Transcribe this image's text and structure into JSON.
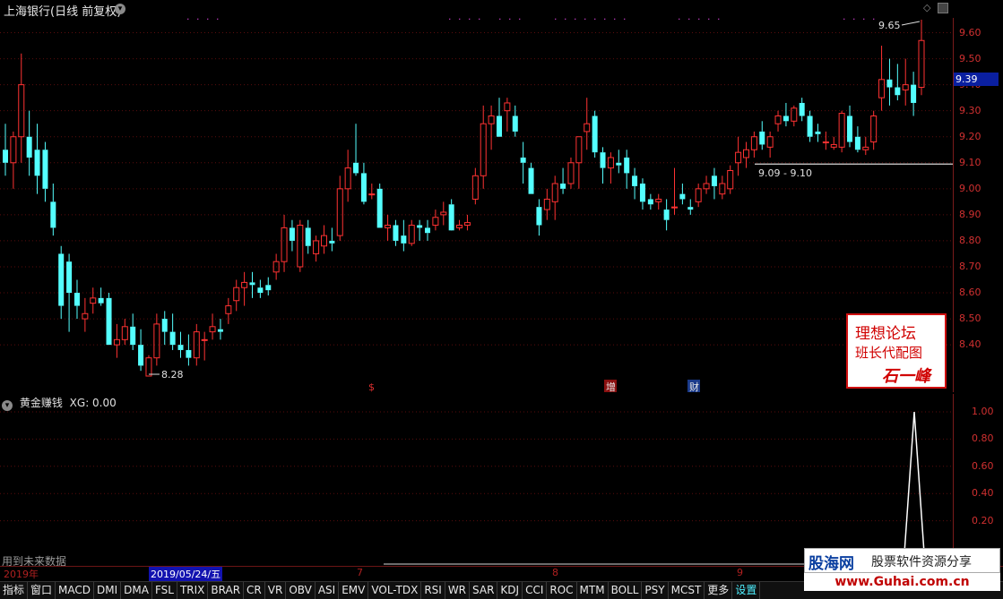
{
  "window": {
    "title": "上海银行(日线 前复权)",
    "title_dropdown_icon": "chevron-down-icon"
  },
  "main_chart": {
    "y_ticks": [
      "9.60",
      "9.50",
      "9.40",
      "9.30",
      "9.20",
      "9.10",
      "9.00",
      "8.90",
      "8.80",
      "8.70",
      "8.60",
      "8.50",
      "8.40"
    ],
    "current_price": "9.39",
    "annot_high": "9.65",
    "annot_low": "8.28",
    "range_label": "9.09 - 9.10",
    "event_markers": [
      {
        "label": "$",
        "color": "#e03030"
      },
      {
        "label": "增",
        "color": "#e8e8e8",
        "bg": "#8a1010"
      },
      {
        "label": "财",
        "color": "#e8e8e8",
        "bg": "#1a3a8a"
      }
    ],
    "up_color": "#ff3232",
    "down_color": "#54ffff",
    "watermark": {
      "line1": "理想论坛",
      "line2": "班长代配图",
      "line3": "石一峰"
    }
  },
  "indicator": {
    "name": "黄金赚钱",
    "value_text": "XG: 0.00",
    "y_ticks": [
      "1.00",
      "0.80",
      "0.60",
      "0.40",
      "0.20"
    ],
    "footnote": "用到未来数据"
  },
  "time_axis": {
    "year": "2019年",
    "months": [
      "7",
      "8",
      "9"
    ],
    "selected_date": "2019/05/24/五"
  },
  "tabs": [
    "指标",
    "窗口",
    "MACD",
    "DMI",
    "DMA",
    "FSL",
    "TRIX",
    "BRAR",
    "CR",
    "VR",
    "OBV",
    "ASI",
    "EMV",
    "VOL-TDX",
    "RSI",
    "WR",
    "SAR",
    "KDJ",
    "CCI",
    "ROC",
    "MTM",
    "BOLL",
    "PSY",
    "MCST",
    "更多",
    "设置"
  ],
  "brand": {
    "name": "股海网",
    "slogan": "股票软件资源分享",
    "url": "www.Guhai.com.cn"
  },
  "chart_data": {
    "type": "candlestick",
    "title": "上海银行(日线 前复权)",
    "ylim": [
      8.28,
      9.65
    ],
    "candles": [
      [
        9.15,
        9.25,
        9.05,
        9.1
      ],
      [
        9.1,
        9.22,
        9.0,
        9.2
      ],
      [
        9.2,
        9.52,
        9.1,
        9.4
      ],
      [
        9.2,
        9.3,
        9.05,
        9.12
      ],
      [
        9.15,
        9.25,
        8.98,
        9.05
      ],
      [
        9.15,
        9.18,
        8.95,
        9.0
      ],
      [
        8.95,
        9.02,
        8.82,
        8.85
      ],
      [
        8.75,
        8.78,
        8.5,
        8.55
      ],
      [
        8.72,
        8.75,
        8.45,
        8.6
      ],
      [
        8.6,
        8.65,
        8.5,
        8.55
      ],
      [
        8.5,
        8.58,
        8.45,
        8.52
      ],
      [
        8.56,
        8.62,
        8.52,
        8.58
      ],
      [
        8.58,
        8.62,
        8.55,
        8.56
      ],
      [
        8.58,
        8.6,
        8.4,
        8.4
      ],
      [
        8.4,
        8.48,
        8.35,
        8.42
      ],
      [
        8.42,
        8.5,
        8.4,
        8.47
      ],
      [
        8.47,
        8.52,
        8.38,
        8.4
      ],
      [
        8.4,
        8.46,
        8.3,
        8.32
      ],
      [
        8.28,
        8.36,
        8.28,
        8.35
      ],
      [
        8.35,
        8.52,
        8.32,
        8.48
      ],
      [
        8.5,
        8.53,
        8.4,
        8.45
      ],
      [
        8.45,
        8.52,
        8.38,
        8.4
      ],
      [
        8.4,
        8.45,
        8.35,
        8.38
      ],
      [
        8.38,
        8.44,
        8.32,
        8.35
      ],
      [
        8.35,
        8.48,
        8.32,
        8.45
      ],
      [
        8.42,
        8.45,
        8.34,
        8.42
      ],
      [
        8.45,
        8.52,
        8.42,
        8.47
      ],
      [
        8.46,
        8.5,
        8.42,
        8.45
      ],
      [
        8.52,
        8.58,
        8.48,
        8.55
      ],
      [
        8.57,
        8.65,
        8.53,
        8.62
      ],
      [
        8.62,
        8.68,
        8.55,
        8.64
      ],
      [
        8.64,
        8.68,
        8.58,
        8.63
      ],
      [
        8.62,
        8.65,
        8.58,
        8.6
      ],
      [
        8.63,
        8.66,
        8.59,
        8.61
      ],
      [
        8.68,
        8.75,
        8.65,
        8.72
      ],
      [
        8.72,
        8.9,
        8.68,
        8.85
      ],
      [
        8.85,
        8.88,
        8.76,
        8.8
      ],
      [
        8.7,
        8.88,
        8.68,
        8.86
      ],
      [
        8.85,
        8.88,
        8.75,
        8.78
      ],
      [
        8.75,
        8.82,
        8.72,
        8.8
      ],
      [
        8.78,
        8.86,
        8.75,
        8.82
      ],
      [
        8.8,
        8.85,
        8.76,
        8.79
      ],
      [
        8.82,
        9.05,
        8.8,
        9.0
      ],
      [
        9.0,
        9.15,
        8.95,
        9.08
      ],
      [
        9.1,
        9.25,
        9.05,
        9.06
      ],
      [
        9.06,
        9.1,
        8.94,
        8.95
      ],
      [
        8.98,
        9.02,
        8.96,
        8.98
      ],
      [
        9.0,
        9.02,
        8.85,
        8.85
      ],
      [
        8.85,
        8.9,
        8.8,
        8.86
      ],
      [
        8.86,
        8.88,
        8.78,
        8.8
      ],
      [
        8.82,
        8.88,
        8.76,
        8.79
      ],
      [
        8.79,
        8.88,
        8.78,
        8.86
      ],
      [
        8.86,
        8.88,
        8.8,
        8.85
      ],
      [
        8.85,
        8.88,
        8.8,
        8.83
      ],
      [
        8.86,
        8.92,
        8.84,
        8.89
      ],
      [
        8.9,
        8.95,
        8.86,
        8.91
      ],
      [
        8.94,
        8.96,
        8.85,
        8.84
      ],
      [
        8.85,
        8.88,
        8.84,
        8.86
      ],
      [
        8.86,
        8.9,
        8.84,
        8.87
      ],
      [
        8.96,
        9.08,
        8.94,
        9.05
      ],
      [
        9.05,
        9.32,
        9.0,
        9.25
      ],
      [
        9.25,
        9.32,
        9.15,
        9.28
      ],
      [
        9.28,
        9.35,
        9.2,
        9.2
      ],
      [
        9.3,
        9.35,
        9.22,
        9.33
      ],
      [
        9.28,
        9.32,
        9.2,
        9.22
      ],
      [
        9.12,
        9.18,
        9.02,
        9.1
      ],
      [
        9.08,
        9.1,
        8.98,
        8.98
      ],
      [
        8.93,
        8.96,
        8.82,
        8.86
      ],
      [
        8.92,
        9.0,
        8.88,
        8.96
      ],
      [
        8.95,
        9.05,
        8.88,
        9.02
      ],
      [
        9.02,
        9.08,
        8.98,
        9.0
      ],
      [
        9.02,
        9.12,
        9.0,
        9.1
      ],
      [
        9.1,
        9.2,
        9.0,
        9.2
      ],
      [
        9.22,
        9.35,
        9.15,
        9.25
      ],
      [
        9.28,
        9.3,
        9.12,
        9.14
      ],
      [
        9.14,
        9.16,
        9.02,
        9.08
      ],
      [
        9.08,
        9.14,
        9.02,
        9.12
      ],
      [
        9.1,
        9.15,
        9.06,
        9.09
      ],
      [
        9.12,
        9.15,
        9.0,
        9.06
      ],
      [
        9.05,
        9.08,
        8.96,
        9.01
      ],
      [
        9.02,
        9.04,
        8.92,
        8.95
      ],
      [
        8.96,
        8.98,
        8.92,
        8.94
      ],
      [
        8.95,
        8.98,
        8.92,
        8.96
      ],
      [
        8.92,
        8.96,
        8.84,
        8.88
      ],
      [
        8.93,
        9.08,
        8.9,
        8.93
      ],
      [
        8.98,
        9.02,
        8.94,
        8.96
      ],
      [
        8.93,
        8.96,
        8.9,
        8.92
      ],
      [
        8.95,
        9.02,
        8.93,
        9.0
      ],
      [
        9.0,
        9.05,
        8.98,
        9.02
      ],
      [
        9.05,
        9.08,
        8.96,
        9.01
      ],
      [
        8.98,
        9.05,
        8.96,
        9.02
      ],
      [
        9.0,
        9.09,
        8.98,
        9.07
      ],
      [
        9.1,
        9.2,
        9.05,
        9.14
      ],
      [
        9.12,
        9.18,
        9.08,
        9.15
      ],
      [
        9.15,
        9.22,
        9.12,
        9.2
      ],
      [
        9.22,
        9.26,
        9.15,
        9.17
      ],
      [
        9.16,
        9.22,
        9.12,
        9.2
      ],
      [
        9.25,
        9.3,
        9.22,
        9.28
      ],
      [
        9.28,
        9.33,
        9.24,
        9.26
      ],
      [
        9.26,
        9.32,
        9.24,
        9.31
      ],
      [
        9.33,
        9.35,
        9.26,
        9.28
      ],
      [
        9.28,
        9.3,
        9.18,
        9.2
      ],
      [
        9.22,
        9.25,
        9.18,
        9.21
      ],
      [
        9.18,
        9.22,
        9.15,
        9.18
      ],
      [
        9.16,
        9.2,
        9.15,
        9.17
      ],
      [
        9.16,
        9.3,
        9.14,
        9.29
      ],
      [
        9.28,
        9.32,
        9.16,
        9.18
      ],
      [
        9.2,
        9.24,
        9.14,
        9.15
      ],
      [
        9.15,
        9.2,
        9.13,
        9.16
      ],
      [
        9.18,
        9.3,
        9.15,
        9.28
      ],
      [
        9.35,
        9.55,
        9.3,
        9.42
      ],
      [
        9.42,
        9.5,
        9.32,
        9.39
      ],
      [
        9.39,
        9.48,
        9.34,
        9.36
      ],
      [
        9.38,
        9.5,
        9.32,
        9.4
      ],
      [
        9.4,
        9.45,
        9.28,
        9.33
      ],
      [
        9.39,
        9.65,
        9.36,
        9.57
      ]
    ],
    "indicator_series": {
      "name": "XG",
      "spike_value": 1.0
    }
  }
}
